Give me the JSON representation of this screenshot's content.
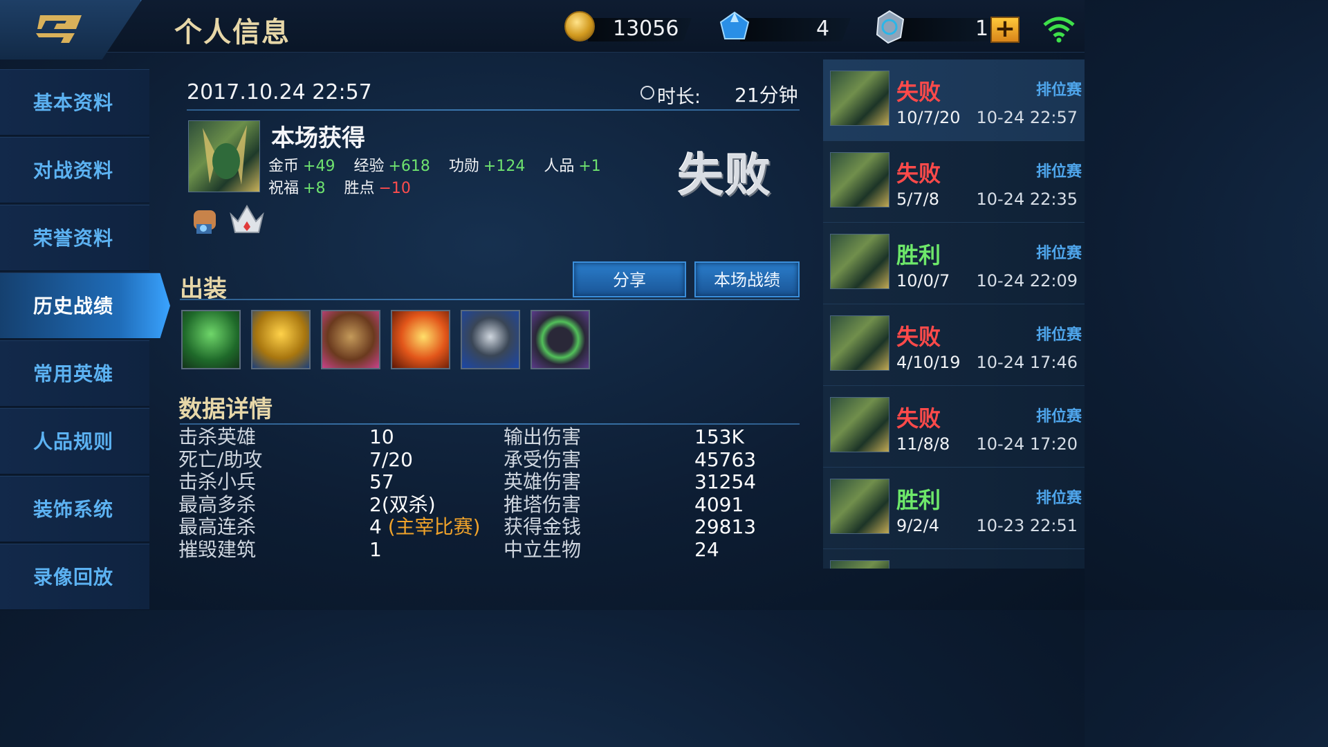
{
  "header": {
    "title": "个人信息",
    "gold": "13056",
    "diamonds": "4",
    "coupons": "1",
    "plus": "+"
  },
  "sidebar": {
    "items": [
      "基本资料",
      "对战资料",
      "荣誉资料",
      "历史战绩",
      "常用英雄",
      "人品规则",
      "装饰系统",
      "录像回放"
    ],
    "active": "历史战绩"
  },
  "match": {
    "date": "2017.10.24 22:57",
    "duration_label": "时长:",
    "duration": "21分钟",
    "gain_title": "本场获得",
    "gains_row1": [
      {
        "label": "金币",
        "value": "+49"
      },
      {
        "label": "经验",
        "value": "+618"
      },
      {
        "label": "功勋",
        "value": "+124"
      },
      {
        "label": "人品",
        "value": "+1"
      }
    ],
    "gains_row2": [
      {
        "label": "祝福",
        "value": "+8"
      },
      {
        "label": "胜点",
        "value": "−10"
      }
    ],
    "result": "失败",
    "equipment_title": "出装",
    "share_button": "分享",
    "scoreboard_button": "本场战绩",
    "details_title": "数据详情",
    "stats_left": [
      {
        "label": "击杀英雄",
        "value": "10"
      },
      {
        "label": "死亡/助攻",
        "value": "7/20"
      },
      {
        "label": "击杀小兵",
        "value": "57"
      },
      {
        "label": "最高多杀",
        "value": "2(双杀)"
      },
      {
        "label": "最高连杀",
        "value": "4",
        "extra": "(主宰比赛)"
      },
      {
        "label": "摧毁建筑",
        "value": "1"
      }
    ],
    "stats_right": [
      {
        "label": "输出伤害",
        "value": "153K"
      },
      {
        "label": "承受伤害",
        "value": "45763"
      },
      {
        "label": "英雄伤害",
        "value": "31254"
      },
      {
        "label": "推塔伤害",
        "value": "4091"
      },
      {
        "label": "获得金钱",
        "value": "29813"
      },
      {
        "label": "中立生物",
        "value": "24"
      }
    ]
  },
  "history": [
    {
      "result": "失败",
      "mode": "排位赛",
      "kda": "10/7/20",
      "time": "10-24 22:57"
    },
    {
      "result": "失败",
      "mode": "排位赛",
      "kda": "5/7/8",
      "time": "10-24 22:35"
    },
    {
      "result": "胜利",
      "mode": "排位赛",
      "kda": "10/0/7",
      "time": "10-24 22:09"
    },
    {
      "result": "失败",
      "mode": "排位赛",
      "kda": "4/10/19",
      "time": "10-24 17:46"
    },
    {
      "result": "失败",
      "mode": "排位赛",
      "kda": "11/8/8",
      "time": "10-24 17:20"
    },
    {
      "result": "胜利",
      "mode": "排位赛",
      "kda": "9/2/4",
      "time": "10-23 22:51"
    }
  ]
}
